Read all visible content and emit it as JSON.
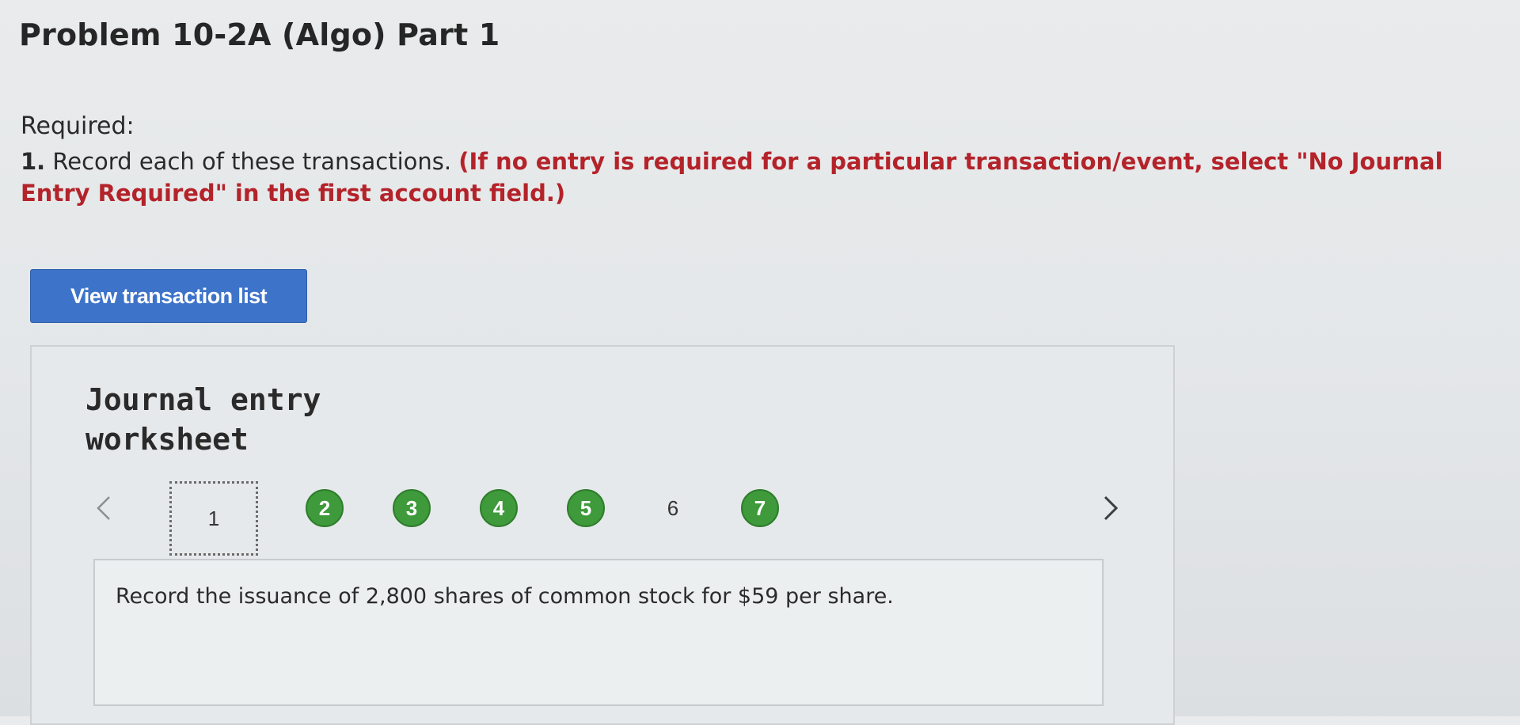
{
  "page": {
    "title": "Problem 10-2A (Algo) Part 1"
  },
  "required": {
    "heading": "Required:",
    "item_number": "1.",
    "instruction": " Record each of these transactions. ",
    "note": "(If no entry is required for a particular transaction/event, select \"No Journal Entry Required\" in the first account field.)"
  },
  "buttons": {
    "view_transaction_list": "View transaction list"
  },
  "worksheet": {
    "title": "Journal entry\nworksheet",
    "nav_prev_icon": "chevron-left-icon",
    "nav_next_icon": "chevron-right-icon",
    "steps": [
      {
        "label": "1",
        "status": "current"
      },
      {
        "label": "2",
        "status": "completed"
      },
      {
        "label": "3",
        "status": "completed"
      },
      {
        "label": "4",
        "status": "completed"
      },
      {
        "label": "5",
        "status": "completed"
      },
      {
        "label": "6",
        "status": "incomplete"
      },
      {
        "label": "7",
        "status": "completed"
      }
    ],
    "transaction_text": "Record the issuance of 2,800 shares of common stock for $59 per share."
  },
  "colors": {
    "button_blue": "#3d73c9",
    "completed_green": "#3e9a3a",
    "note_red": "#b4232a"
  }
}
